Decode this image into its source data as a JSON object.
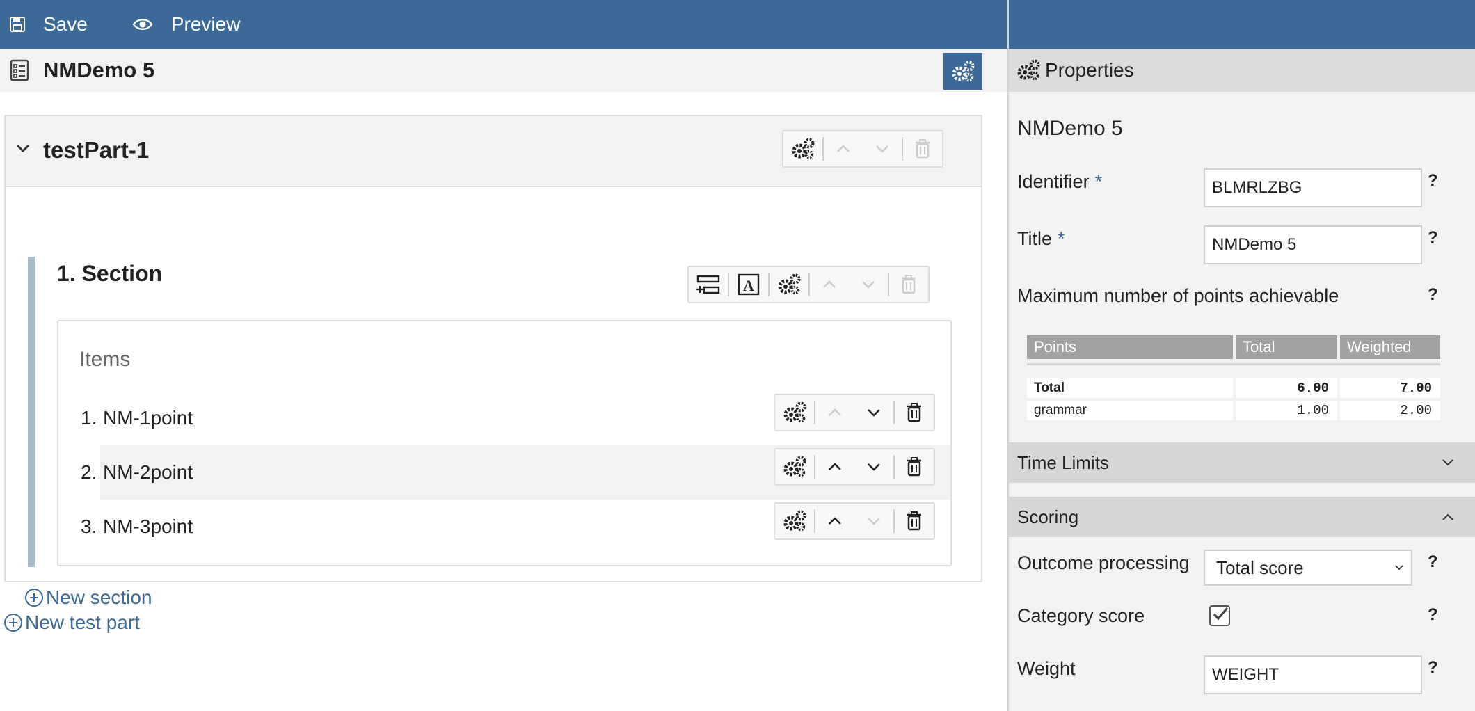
{
  "toolbar": {
    "save_label": "Save",
    "preview_label": "Preview"
  },
  "test": {
    "title": "NMDemo 5"
  },
  "test_part": {
    "title": "testPart-1",
    "section": {
      "title": "1. Section",
      "items_label": "Items",
      "items": [
        {
          "num": "1.",
          "name": "NM-1point"
        },
        {
          "num": "2.",
          "name": "NM-2point"
        },
        {
          "num": "3.",
          "name": "NM-3point"
        }
      ]
    },
    "new_section_label": "New section"
  },
  "new_test_part_label": "New test part",
  "properties": {
    "header": "Properties",
    "name": "NMDemo 5",
    "identifier_label": "Identifier",
    "identifier_value": "BLMRLZBG",
    "title_label": "Title",
    "title_value": "NMDemo 5",
    "required_mark": "*",
    "help_mark": "?",
    "max_points_label": "Maximum number of points achievable",
    "points_table": {
      "headers": [
        "Points",
        "Total",
        "Weighted"
      ],
      "rows": [
        {
          "label": "Total",
          "total": "6.00",
          "weighted": "7.00",
          "bold": true
        },
        {
          "label": "grammar",
          "total": "1.00",
          "weighted": "2.00",
          "bold": false
        }
      ]
    },
    "time_limits_label": "Time Limits",
    "scoring_label": "Scoring",
    "outcome_processing_label": "Outcome processing",
    "outcome_processing_value": "Total score",
    "category_score_label": "Category score",
    "category_score_checked": true,
    "weight_label": "Weight",
    "weight_value": "WEIGHT"
  }
}
